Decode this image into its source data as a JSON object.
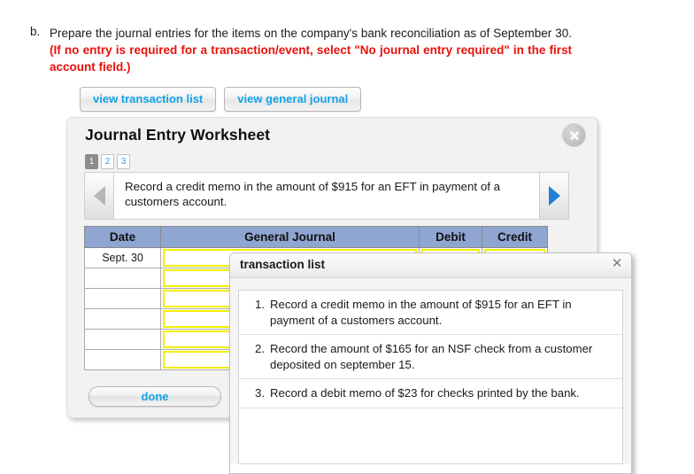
{
  "question": {
    "letter": "b.",
    "text_plain": "Prepare the journal entries for the items on the company's bank reconciliation as of September 30. ",
    "text_red": "(If no entry is required for a transaction/event, select \"No journal entry required\" in the first account field.)"
  },
  "toolbar": {
    "view_transaction_list_label": "view transaction list",
    "view_general_journal_label": "view general journal"
  },
  "worksheet": {
    "title": "Journal Entry Worksheet",
    "close_icon": "close-circle-icon",
    "pagination": [
      {
        "label": "1",
        "active": true
      },
      {
        "label": "2",
        "active": false
      },
      {
        "label": "3",
        "active": false
      }
    ],
    "nav": {
      "prev_icon": "triangle-left-icon",
      "next_icon": "triangle-right-icon",
      "prev_enabled": false,
      "next_enabled": true,
      "prompt": "Record a credit memo in the amount of $915 for an EFT in payment of a customers account."
    },
    "table": {
      "headers": [
        "Date",
        "General Journal",
        "Debit",
        "Credit"
      ],
      "rows": [
        {
          "date": "Sept. 30",
          "general_journal": "",
          "debit": "",
          "credit": ""
        },
        {
          "date": "",
          "general_journal": "",
          "debit": "",
          "credit": ""
        },
        {
          "date": "",
          "general_journal": "",
          "debit": "",
          "credit": ""
        },
        {
          "date": "",
          "general_journal": "",
          "debit": "",
          "credit": ""
        },
        {
          "date": "",
          "general_journal": "",
          "debit": "",
          "credit": ""
        },
        {
          "date": "",
          "general_journal": "",
          "debit": "",
          "credit": ""
        }
      ]
    },
    "done_label": "done"
  },
  "dialog": {
    "title": "transaction list",
    "close_icon": "close-x-icon",
    "items": [
      {
        "number": "1.",
        "text": "Record a credit memo in the amount of $915 for an EFT in payment of a customers account."
      },
      {
        "number": "2.",
        "text": "Record the amount of $165 for an NSF check from a customer deposited on september 15."
      },
      {
        "number": "3.",
        "text": "Record a debit memo of $23 for checks printed by the bank."
      }
    ]
  },
  "colors": {
    "accent_blue": "#13a3e8",
    "red_note": "#e8110b",
    "table_header": "#8fa5d2",
    "input_yellow": "#f2ef00"
  }
}
